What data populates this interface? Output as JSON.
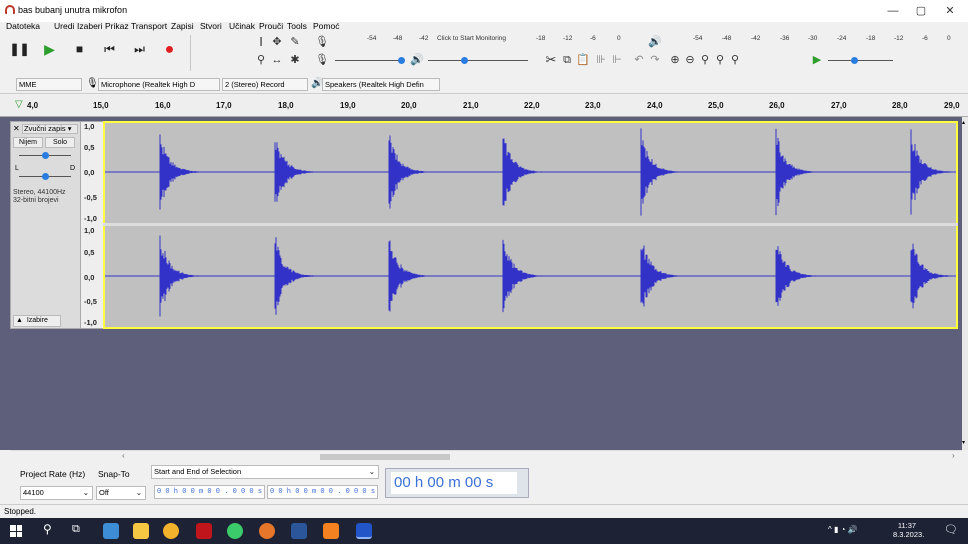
{
  "window": {
    "title": "bas bubanj unutra mikrofon",
    "min": "—",
    "max": "▢",
    "close": "✕"
  },
  "menu": [
    "Datoteka",
    "Uredi",
    "Izaberi",
    "Prikaz",
    "Transport",
    "Zapisi",
    "Stvori",
    "Učinak",
    "Prouči",
    "Tools",
    "Pomoć"
  ],
  "meters": {
    "rec_scale": [
      "-54",
      "-48",
      "-42",
      "Click to Start Monitoring",
      "-18",
      "-12",
      "-6",
      "0"
    ],
    "play_scale": [
      "-54",
      "-48",
      "-42",
      "-36",
      "-30",
      "-24",
      "-18",
      "-12",
      "-6",
      "0"
    ]
  },
  "devices": {
    "host": "MME",
    "mic": "Microphone (Realtek High D",
    "channels": "2 (Stereo) Record",
    "speakers": "Speakers (Realtek High Defin"
  },
  "ruler": [
    "4,0",
    "15,0",
    "16,0",
    "17,0",
    "18,0",
    "19,0",
    "20,0",
    "21,0",
    "22,0",
    "23,0",
    "24,0",
    "25,0",
    "26,0",
    "27,0",
    "28,0",
    "29,0"
  ],
  "track": {
    "name": "Zvučni zapis",
    "mute": "Nijem",
    "solo": "Solo",
    "pan_l": "L",
    "pan_r": "D",
    "info1": "Stereo, 44100Hz",
    "info2": "32-bitni brojevi",
    "select": "Izabire",
    "ch1_scale": [
      "1,0",
      "0,5",
      "0,0",
      "-0,5",
      "-1,0"
    ],
    "ch2_scale": [
      "1,0",
      "0,5",
      "0,0",
      "-0,5",
      "-1,0"
    ]
  },
  "bottom": {
    "rate_label": "Project Rate (Hz)",
    "snap_label": "Snap-To",
    "rate_value": "44100",
    "snap_value": "Off",
    "sel_label": "Start and End of Selection",
    "sel_start": "0 0 h 0 0 m 0 0 . 0 0 0 s",
    "sel_end": "0 0 h 0 0 m 0 0 . 0 0 0 s",
    "time_display": "00 h 00 m 00 s"
  },
  "status": "Stopped.",
  "clock": {
    "time": "11:37",
    "date": "8.3.2023."
  },
  "colors": {
    "waveform": "#3232c8",
    "track_bg": "#c0c0c0",
    "selection_border": "#ffff3c",
    "empty_area": "#5e5f7a",
    "taskbar": "#1d2235"
  }
}
